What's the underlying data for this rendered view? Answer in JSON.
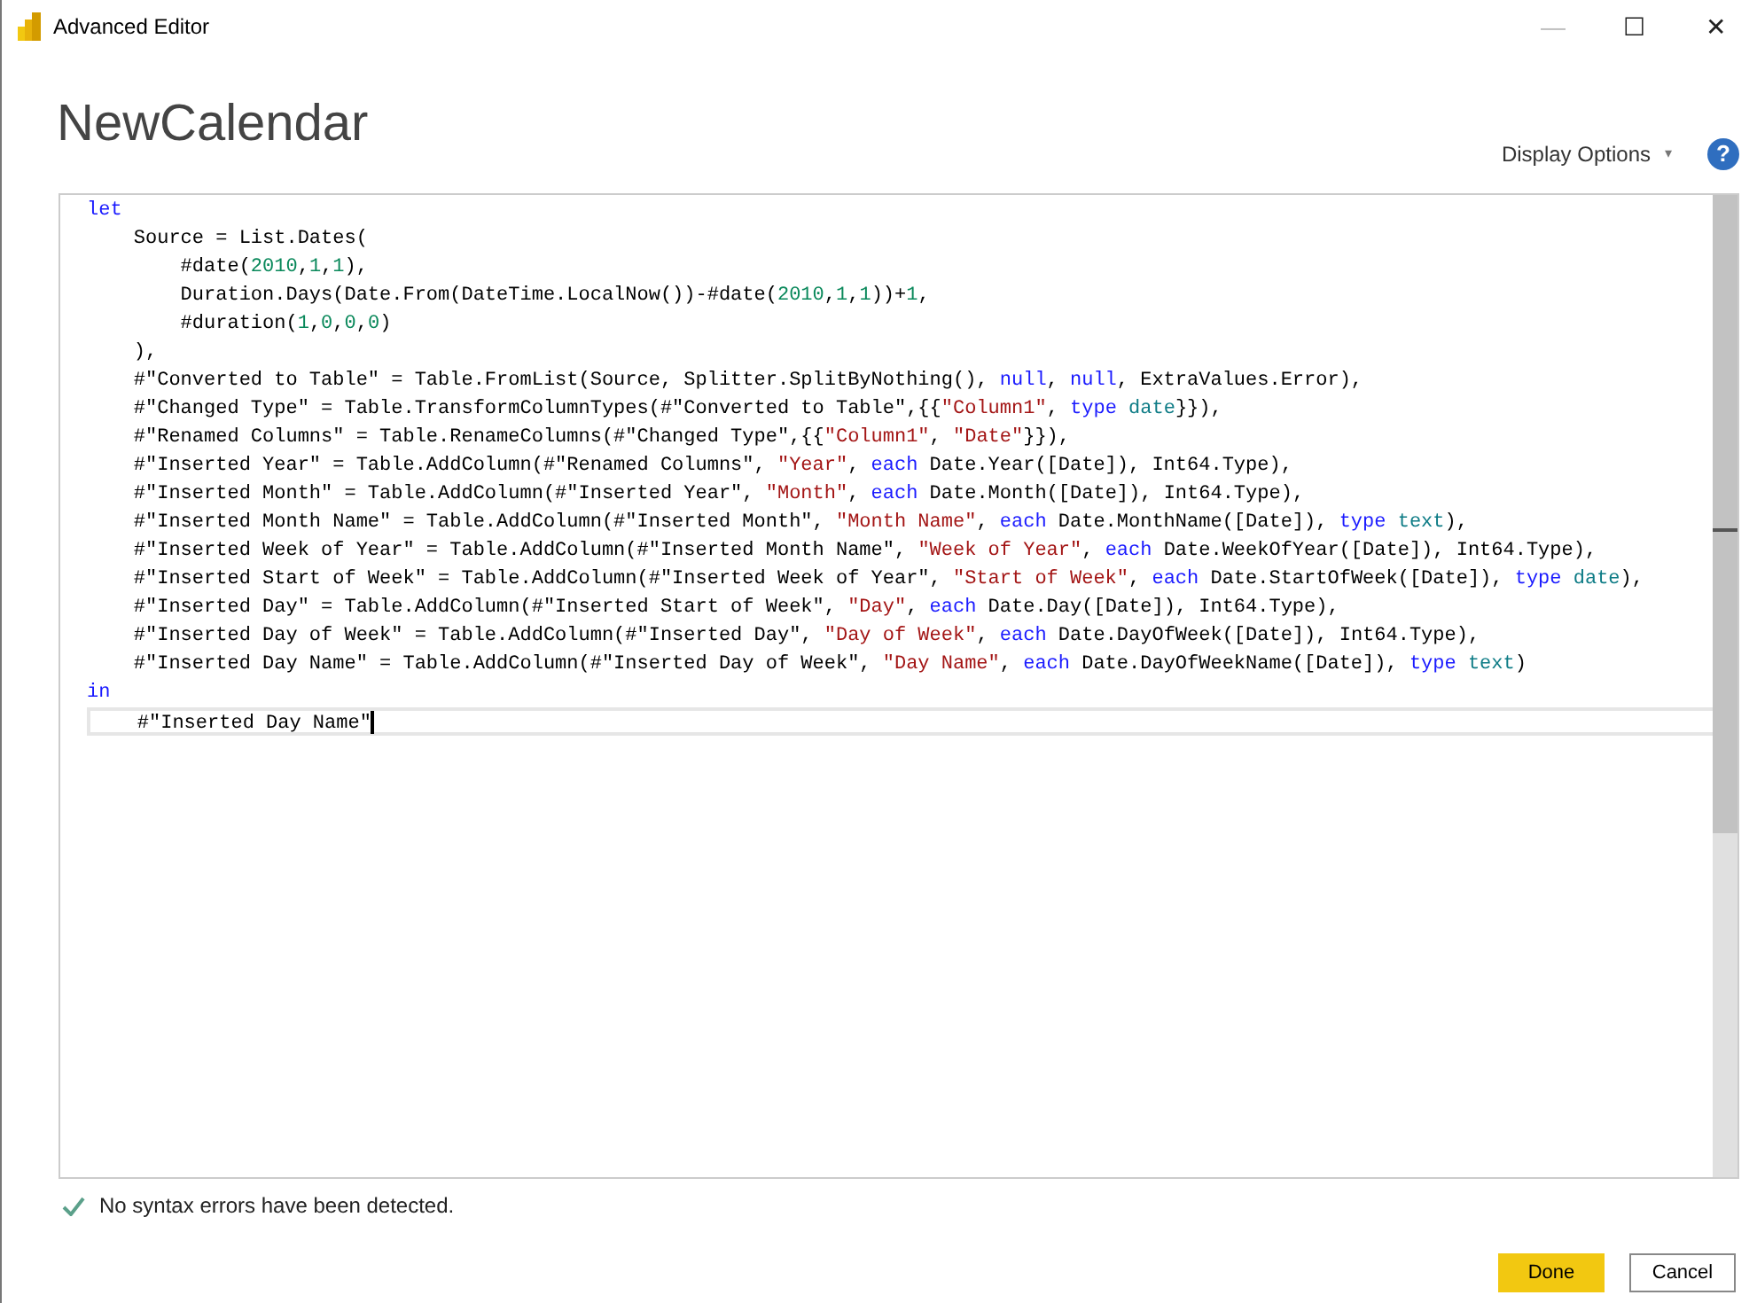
{
  "window": {
    "title": "Advanced Editor",
    "controls": [
      "—",
      "☐",
      "✕"
    ]
  },
  "query_name": "NewCalendar",
  "display_options": {
    "label": "Display Options",
    "caret": "▾"
  },
  "help": {
    "glyph": "?"
  },
  "code_lines": [
    {
      "current": false,
      "tokens": [
        {
          "text": "let",
          "kind": "keyword"
        }
      ]
    },
    {
      "current": false,
      "tokens": [
        {
          "text": "    Source = List.Dates(",
          "kind": "plain"
        }
      ]
    },
    {
      "current": false,
      "tokens": [
        {
          "text": "        #date(",
          "kind": "plain"
        },
        {
          "text": "2010",
          "kind": "number"
        },
        {
          "text": ",",
          "kind": "plain"
        },
        {
          "text": "1",
          "kind": "number"
        },
        {
          "text": ",",
          "kind": "plain"
        },
        {
          "text": "1",
          "kind": "number"
        },
        {
          "text": "),",
          "kind": "plain"
        }
      ]
    },
    {
      "current": false,
      "tokens": [
        {
          "text": "        Duration.Days(Date.From(DateTime.LocalNow())-#date(",
          "kind": "plain"
        },
        {
          "text": "2010",
          "kind": "number"
        },
        {
          "text": ",",
          "kind": "plain"
        },
        {
          "text": "1",
          "kind": "number"
        },
        {
          "text": ",",
          "kind": "plain"
        },
        {
          "text": "1",
          "kind": "number"
        },
        {
          "text": "))+",
          "kind": "plain"
        },
        {
          "text": "1",
          "kind": "number"
        },
        {
          "text": ",",
          "kind": "plain"
        }
      ]
    },
    {
      "current": false,
      "tokens": [
        {
          "text": "        #duration(",
          "kind": "plain"
        },
        {
          "text": "1",
          "kind": "number"
        },
        {
          "text": ",",
          "kind": "plain"
        },
        {
          "text": "0",
          "kind": "number"
        },
        {
          "text": ",",
          "kind": "plain"
        },
        {
          "text": "0",
          "kind": "number"
        },
        {
          "text": ",",
          "kind": "plain"
        },
        {
          "text": "0",
          "kind": "number"
        },
        {
          "text": ")",
          "kind": "plain"
        }
      ]
    },
    {
      "current": false,
      "tokens": [
        {
          "text": "    ),",
          "kind": "plain"
        }
      ]
    },
    {
      "current": false,
      "tokens": [
        {
          "text": "    #\"Converted to Table\" = Table.FromList(Source, Splitter.SplitByNothing(), ",
          "kind": "plain"
        },
        {
          "text": "null",
          "kind": "keyword"
        },
        {
          "text": ", ",
          "kind": "plain"
        },
        {
          "text": "null",
          "kind": "keyword"
        },
        {
          "text": ", ExtraValues.Error),",
          "kind": "plain"
        }
      ]
    },
    {
      "current": false,
      "tokens": [
        {
          "text": "    #\"Changed Type\" = Table.TransformColumnTypes(#\"Converted to Table\",{{",
          "kind": "plain"
        },
        {
          "text": "\"Column1\"",
          "kind": "string"
        },
        {
          "text": ", ",
          "kind": "plain"
        },
        {
          "text": "type ",
          "kind": "keyword"
        },
        {
          "text": "date",
          "kind": "typename"
        },
        {
          "text": "}}),",
          "kind": "plain"
        }
      ]
    },
    {
      "current": false,
      "tokens": [
        {
          "text": "    #\"Renamed Columns\" = Table.RenameColumns(#\"Changed Type\",{{",
          "kind": "plain"
        },
        {
          "text": "\"Column1\"",
          "kind": "string"
        },
        {
          "text": ", ",
          "kind": "plain"
        },
        {
          "text": "\"Date\"",
          "kind": "string"
        },
        {
          "text": "}}),",
          "kind": "plain"
        }
      ]
    },
    {
      "current": false,
      "tokens": [
        {
          "text": "    #\"Inserted Year\" = Table.AddColumn(#\"Renamed Columns\", ",
          "kind": "plain"
        },
        {
          "text": "\"Year\"",
          "kind": "string"
        },
        {
          "text": ", ",
          "kind": "plain"
        },
        {
          "text": "each",
          "kind": "keyword"
        },
        {
          "text": " Date.Year([Date]), Int64.Type),",
          "kind": "plain"
        }
      ]
    },
    {
      "current": false,
      "tokens": [
        {
          "text": "    #\"Inserted Month\" = Table.AddColumn(#\"Inserted Year\", ",
          "kind": "plain"
        },
        {
          "text": "\"Month\"",
          "kind": "string"
        },
        {
          "text": ", ",
          "kind": "plain"
        },
        {
          "text": "each",
          "kind": "keyword"
        },
        {
          "text": " Date.Month([Date]), Int64.Type),",
          "kind": "plain"
        }
      ]
    },
    {
      "current": false,
      "tokens": [
        {
          "text": "    #\"Inserted Month Name\" = Table.AddColumn(#\"Inserted Month\", ",
          "kind": "plain"
        },
        {
          "text": "\"Month Name\"",
          "kind": "string"
        },
        {
          "text": ", ",
          "kind": "plain"
        },
        {
          "text": "each",
          "kind": "keyword"
        },
        {
          "text": " Date.MonthName([Date]), ",
          "kind": "plain"
        },
        {
          "text": "type ",
          "kind": "keyword"
        },
        {
          "text": "text",
          "kind": "typename"
        },
        {
          "text": "),",
          "kind": "plain"
        }
      ]
    },
    {
      "current": false,
      "tokens": [
        {
          "text": "    #\"Inserted Week of Year\" = Table.AddColumn(#\"Inserted Month Name\", ",
          "kind": "plain"
        },
        {
          "text": "\"Week of Year\"",
          "kind": "string"
        },
        {
          "text": ", ",
          "kind": "plain"
        },
        {
          "text": "each",
          "kind": "keyword"
        },
        {
          "text": " Date.WeekOfYear([Date]), Int64.Type),",
          "kind": "plain"
        }
      ]
    },
    {
      "current": false,
      "tokens": [
        {
          "text": "    #\"Inserted Start of Week\" = Table.AddColumn(#\"Inserted Week of Year\", ",
          "kind": "plain"
        },
        {
          "text": "\"Start of Week\"",
          "kind": "string"
        },
        {
          "text": ", ",
          "kind": "plain"
        },
        {
          "text": "each",
          "kind": "keyword"
        },
        {
          "text": " Date.StartOfWeek([Date]), ",
          "kind": "plain"
        },
        {
          "text": "type ",
          "kind": "keyword"
        },
        {
          "text": "date",
          "kind": "typename"
        },
        {
          "text": "),",
          "kind": "plain"
        }
      ]
    },
    {
      "current": false,
      "tokens": [
        {
          "text": "    #\"Inserted Day\" = Table.AddColumn(#\"Inserted Start of Week\", ",
          "kind": "plain"
        },
        {
          "text": "\"Day\"",
          "kind": "string"
        },
        {
          "text": ", ",
          "kind": "plain"
        },
        {
          "text": "each",
          "kind": "keyword"
        },
        {
          "text": " Date.Day([Date]), Int64.Type),",
          "kind": "plain"
        }
      ]
    },
    {
      "current": false,
      "tokens": [
        {
          "text": "    #\"Inserted Day of Week\" = Table.AddColumn(#\"Inserted Day\", ",
          "kind": "plain"
        },
        {
          "text": "\"Day of Week\"",
          "kind": "string"
        },
        {
          "text": ", ",
          "kind": "plain"
        },
        {
          "text": "each",
          "kind": "keyword"
        },
        {
          "text": " Date.DayOfWeek([Date]), Int64.Type),",
          "kind": "plain"
        }
      ]
    },
    {
      "current": false,
      "tokens": [
        {
          "text": "    #\"Inserted Day Name\" = Table.AddColumn(#\"Inserted Day of Week\", ",
          "kind": "plain"
        },
        {
          "text": "\"Day Name\"",
          "kind": "string"
        },
        {
          "text": ", ",
          "kind": "plain"
        },
        {
          "text": "each",
          "kind": "keyword"
        },
        {
          "text": " Date.DayOfWeekName([Date]), ",
          "kind": "plain"
        },
        {
          "text": "type ",
          "kind": "keyword"
        },
        {
          "text": "text",
          "kind": "typename"
        },
        {
          "text": ")",
          "kind": "plain"
        }
      ]
    },
    {
      "current": false,
      "tokens": [
        {
          "text": "in",
          "kind": "keyword"
        }
      ]
    },
    {
      "current": true,
      "tokens": [
        {
          "text": "    #\"Inserted Day Name\"",
          "kind": "plain"
        }
      ]
    }
  ],
  "status": {
    "text": "No syntax errors have been detected.",
    "ok": true
  },
  "buttons": [
    {
      "label": "Done",
      "primary": true
    },
    {
      "label": "Cancel",
      "primary": false
    }
  ]
}
